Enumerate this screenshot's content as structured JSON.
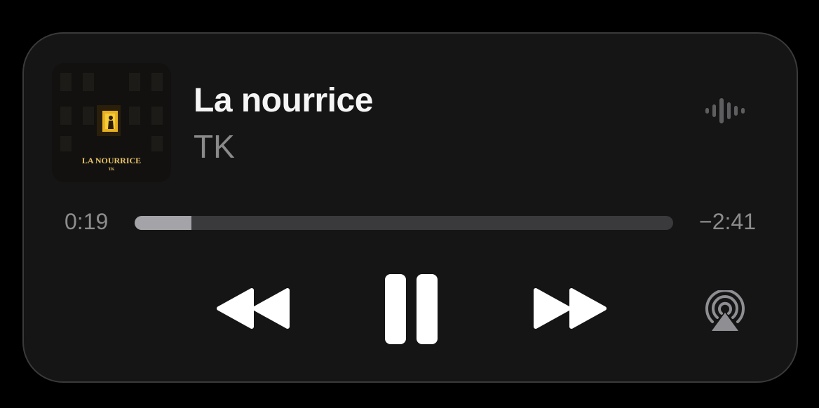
{
  "now_playing": {
    "title": "La nourrice",
    "artist": "TK",
    "artwork": {
      "title_text": "LA NOURRICE",
      "artist_text": "TK"
    }
  },
  "progress": {
    "elapsed": "0:19",
    "remaining": "−2:41",
    "fraction": 0.106
  },
  "controls": {
    "rewind_icon": "backward-icon",
    "pause_icon": "pause-icon",
    "forward_icon": "forward-icon",
    "airplay_icon": "airplay-icon",
    "waveform_icon": "waveform-icon"
  },
  "colors": {
    "background": "#000000",
    "panel": "#151515",
    "title": "#f5f5f5",
    "secondary_text": "#8a8a8a",
    "track": "#3a3a3c",
    "track_fill": "#a3a3a8",
    "artwork_accent": "#e8b020"
  }
}
